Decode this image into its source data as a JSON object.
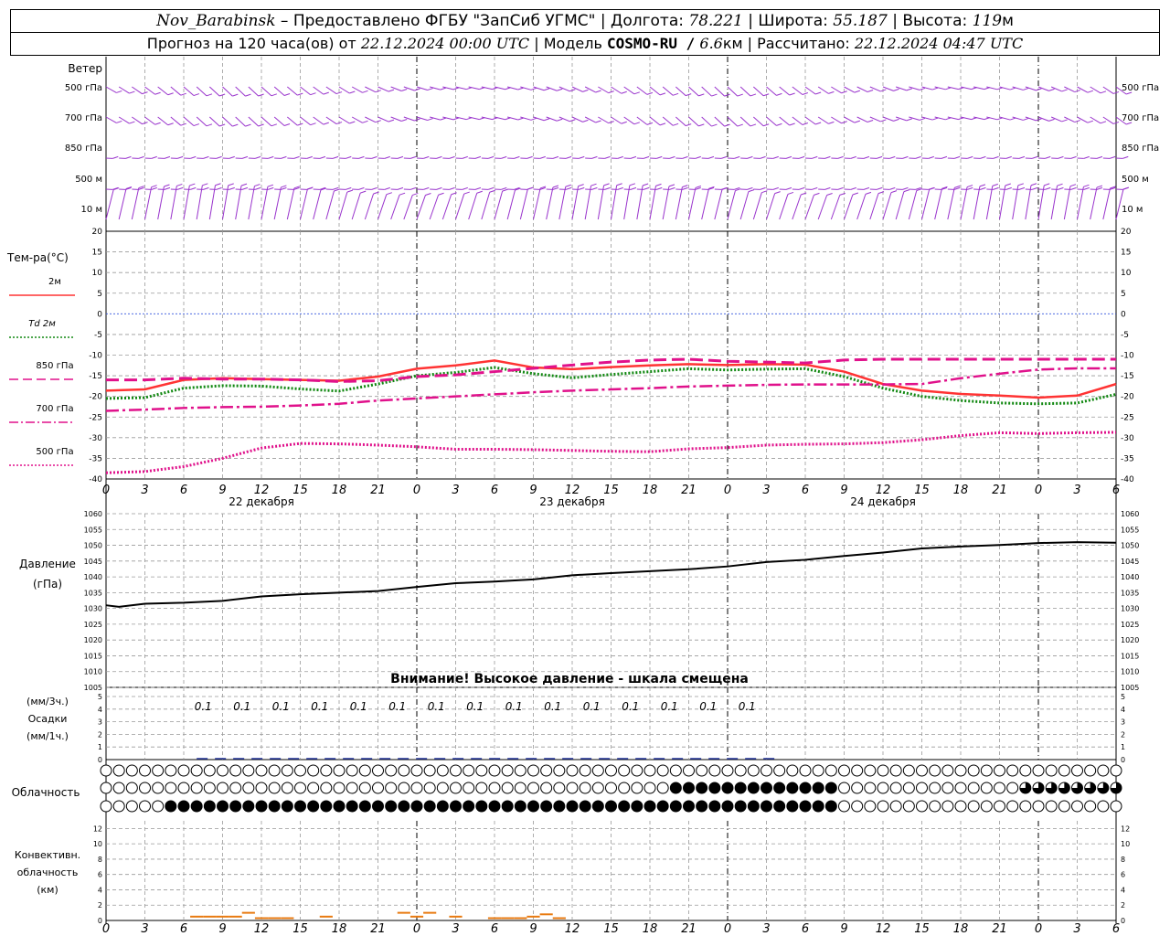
{
  "header": {
    "station": "Nov_Barabinsk",
    "provider": "Предоставлено ФГБУ \"ЗапСиб УГМС\"",
    "lon_label": "Долгота:",
    "lon_value": "78.221",
    "lat_label": "Широта:",
    "lat_value": "55.187",
    "alt_label": "Высота:",
    "alt_value": "119",
    "alt_unit": "м",
    "forecast_label": "Прогноз на 120 часа(ов) от",
    "forecast_start": "22.12.2024 00:00 UTC",
    "model_label": "Модель",
    "model_name": "COSMO-RU /",
    "model_res": "6.6",
    "model_res_unit": "км",
    "computed_label": "Рассчитано:",
    "computed_value": "22.12.2024 04:47 UTC"
  },
  "panels": {
    "wind": {
      "title": "Ветер",
      "levels": [
        "500 гПа",
        "700 гПа",
        "850 гПа",
        "500 м",
        "10  м"
      ],
      "color": "#9933cc"
    },
    "temperature": {
      "title": "Тем-ра(°С)",
      "legend": [
        {
          "label": "2м",
          "color": "#ff3333",
          "style": "solid"
        },
        {
          "label": "Td 2м",
          "color": "#118811",
          "style": "dotted"
        },
        {
          "label": "850 гПа",
          "color": "#e0118b",
          "style": "dashed"
        },
        {
          "label": "700 гПа",
          "color": "#e0118b",
          "style": "dashdot"
        },
        {
          "label": "500 гПа",
          "color": "#e0118b",
          "style": "dotted"
        }
      ],
      "yticks": [
        20,
        15,
        10,
        5,
        0,
        -5,
        -10,
        -15,
        -20,
        -25,
        -30,
        -35,
        -40
      ]
    },
    "pressure": {
      "title": "Давление",
      "unit": "(гПа)",
      "warning": "Внимание! Высокое давление - шкала смещена",
      "yticks": [
        1060,
        1055,
        1050,
        1045,
        1040,
        1035,
        1030,
        1025,
        1020,
        1015,
        1010,
        1005
      ]
    },
    "precip": {
      "unit3": "(мм/3ч.)",
      "title": "Осадки",
      "unit1": "(мм/1ч.)",
      "yticks": [
        5,
        4,
        3,
        2,
        1,
        0
      ],
      "labels": [
        "0.1",
        "0.1",
        "0.1",
        "0.1",
        "0.1",
        "0.1",
        "0.1",
        "0.1",
        "0.1",
        "0.1",
        "0.1",
        "0.1",
        "0.1",
        "0.1",
        "0.1"
      ]
    },
    "clouds": {
      "title": "Облачность"
    },
    "convective": {
      "title_lines": [
        "Конвективн.",
        "облачность",
        "(км)"
      ],
      "yticks": [
        12,
        10,
        8,
        6,
        4,
        2,
        0
      ]
    }
  },
  "time_axis": {
    "hour_labels": [
      "0",
      "3",
      "6",
      "9",
      "12",
      "15",
      "18",
      "21",
      "0",
      "3",
      "6",
      "9",
      "12",
      "15",
      "18",
      "21",
      "0",
      "3",
      "6",
      "9",
      "12",
      "15",
      "18",
      "21",
      "0",
      "3",
      "6"
    ],
    "day_labels": [
      "22 декабря",
      "23 декабря",
      "24 декабря"
    ]
  },
  "chart_data": [
    {
      "type": "line",
      "panel": "temperature",
      "x_unit": "hours since 22.12.2024 00:00 UTC",
      "ylim": [
        -40,
        20
      ],
      "series": [
        {
          "name": "2м",
          "x": [
            0,
            3,
            6,
            9,
            12,
            15,
            18,
            21,
            24,
            27,
            30,
            33,
            36,
            39,
            42,
            45,
            48,
            51,
            54,
            57,
            60,
            63,
            66,
            69,
            72,
            75,
            78
          ],
          "values": [
            -18.6,
            -18.3,
            -16,
            -15.6,
            -15.8,
            -16,
            -16.2,
            -15.2,
            -13.3,
            -12.5,
            -11.3,
            -13,
            -13.4,
            -12.9,
            -12.5,
            -12.2,
            -12.4,
            -12.2,
            -12.3,
            -14,
            -17,
            -18.6,
            -19.4,
            -19.8,
            -20.3,
            -19.8,
            -17
          ]
        },
        {
          "name": "Td 2м",
          "x": [
            0,
            3,
            6,
            9,
            12,
            15,
            18,
            21,
            24,
            27,
            30,
            33,
            36,
            39,
            42,
            45,
            48,
            51,
            54,
            57,
            60,
            63,
            66,
            69,
            72,
            75,
            78
          ],
          "values": [
            -20.5,
            -20.3,
            -18,
            -17.4,
            -17.5,
            -18.2,
            -18.7,
            -17,
            -15,
            -14.2,
            -13,
            -14.5,
            -15.5,
            -14.7,
            -14,
            -13.3,
            -13.6,
            -13.4,
            -13.3,
            -15.2,
            -18,
            -20,
            -21,
            -21.6,
            -21.8,
            -21.6,
            -19.5
          ]
        },
        {
          "name": "850 гПа",
          "x": [
            0,
            3,
            6,
            9,
            12,
            15,
            18,
            21,
            24,
            27,
            30,
            33,
            36,
            39,
            42,
            45,
            48,
            51,
            54,
            57,
            60,
            63,
            66,
            69,
            72,
            75,
            78
          ],
          "values": [
            -16,
            -16,
            -15.6,
            -15.8,
            -15.8,
            -16,
            -16.4,
            -16.2,
            -15.2,
            -14.8,
            -14,
            -13.2,
            -12.4,
            -11.7,
            -11.2,
            -11,
            -11.5,
            -11.7,
            -11.9,
            -11.2,
            -11,
            -11,
            -11,
            -11,
            -11,
            -11,
            -11
          ]
        },
        {
          "name": "700 гПа",
          "x": [
            0,
            3,
            6,
            9,
            12,
            15,
            18,
            21,
            24,
            27,
            30,
            33,
            36,
            39,
            42,
            45,
            48,
            51,
            54,
            57,
            60,
            63,
            66,
            69,
            72,
            75,
            78
          ],
          "values": [
            -23.5,
            -23.2,
            -22.8,
            -22.6,
            -22.5,
            -22.2,
            -21.8,
            -21,
            -20.5,
            -20,
            -19.5,
            -19,
            -18.6,
            -18.3,
            -18,
            -17.6,
            -17.4,
            -17.2,
            -17.1,
            -17.1,
            -17.1,
            -17,
            -15.6,
            -14.5,
            -13.5,
            -13.2,
            -13.2
          ]
        },
        {
          "name": "500 гПа",
          "x": [
            0,
            3,
            6,
            9,
            12,
            15,
            18,
            21,
            24,
            27,
            30,
            33,
            36,
            39,
            42,
            45,
            48,
            51,
            54,
            57,
            60,
            63,
            66,
            69,
            72,
            75,
            78
          ],
          "values": [
            -38.5,
            -38.2,
            -37,
            -35,
            -32.5,
            -31.4,
            -31.5,
            -31.8,
            -32.2,
            -32.8,
            -32.8,
            -32.9,
            -33.1,
            -33.3,
            -33.4,
            -32.7,
            -32.4,
            -31.8,
            -31.6,
            -31.5,
            -31.2,
            -30.5,
            -29.5,
            -28.8,
            -29,
            -28.8,
            -28.7
          ]
        }
      ]
    },
    {
      "type": "line",
      "panel": "pressure",
      "x_unit": "hours since 22.12.2024 00:00 UTC",
      "ylim": [
        1005,
        1060
      ],
      "series": [
        {
          "x": [
            0,
            1,
            3,
            6,
            9,
            12,
            15,
            18,
            21,
            24,
            27,
            30,
            33,
            36,
            39,
            42,
            45,
            48,
            51,
            54,
            57,
            60,
            63,
            66,
            69,
            72,
            75,
            78
          ],
          "values": [
            1031,
            1030.5,
            1031.5,
            1031.8,
            1032.4,
            1033.8,
            1034.5,
            1035,
            1035.5,
            1036.8,
            1038,
            1038.5,
            1039.2,
            1040.5,
            1041.2,
            1041.8,
            1042.4,
            1043.3,
            1044.7,
            1045.4,
            1046.6,
            1047.7,
            1049,
            1049.6,
            1050.1,
            1050.7,
            1051,
            1050.8
          ]
        }
      ]
    },
    {
      "type": "bar",
      "panel": "convective",
      "x_unit": "hours since 22.12.2024 00:00 UTC",
      "ylim": [
        0,
        13
      ],
      "x": [
        7,
        8,
        9,
        10,
        11,
        12,
        13,
        14,
        17,
        23,
        24,
        25,
        27,
        30,
        31,
        32,
        33,
        34,
        35
      ],
      "values": [
        0.5,
        0.5,
        0.5,
        0.5,
        1,
        0.3,
        0.3,
        0.3,
        0.5,
        1,
        0.5,
        1,
        0.5,
        0.3,
        0.3,
        0.3,
        0.5,
        0.8,
        0.3
      ]
    }
  ]
}
